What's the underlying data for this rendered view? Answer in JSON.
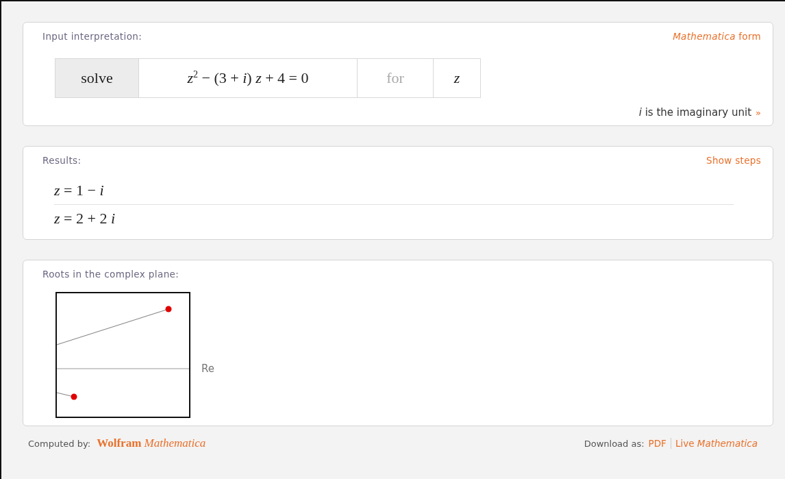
{
  "input_interpretation": {
    "title": "Input interpretation:",
    "link": "*Mathematica* form",
    "cells": [
      {
        "kind": "keyword",
        "text": "solve"
      },
      {
        "kind": "expression",
        "text": "*z*$^{2}$ − (3 + *i*) *z* + 4 = 0"
      },
      {
        "kind": "connector",
        "text": "for"
      },
      {
        "kind": "variable",
        "text": "*z*"
      }
    ],
    "note": "*i* is the imaginary unit",
    "note_link": "»"
  },
  "results": {
    "title": "Results:",
    "link": "Show steps",
    "items": [
      "*z* = 1 − *i*",
      "*z* = 2 + 2 *i*"
    ]
  },
  "roots_plot": {
    "title": "Roots in the complex plane:",
    "axis_label": "Re"
  },
  "footer": {
    "computed_label": "Computed by:",
    "logo_word": "Wolfram",
    "logo_product": "Mathematica",
    "download_label": "Download as:",
    "links": [
      "PDF",
      "Live *Mathematica*"
    ]
  }
}
